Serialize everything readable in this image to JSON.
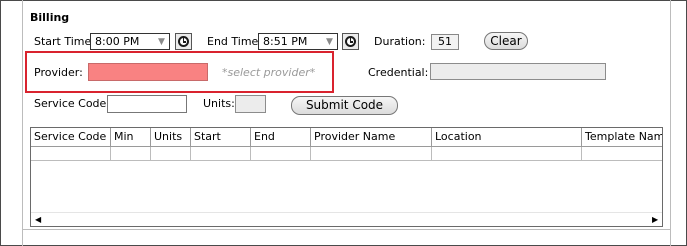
{
  "billing": {
    "title": "Billing",
    "start_time": {
      "label": "Start Time:",
      "value": "8:00 PM"
    },
    "end_time": {
      "label": "End Time:",
      "value": "8:51 PM"
    },
    "duration": {
      "label": "Duration:",
      "value": "51"
    },
    "clear_label": "Clear",
    "provider": {
      "label": "Provider:",
      "placeholder": "*select provider*"
    },
    "credential": {
      "label": "Credential:",
      "value": ""
    },
    "service_code": {
      "label": "Service Code:",
      "value": ""
    },
    "units": {
      "label": "Units:",
      "value": ""
    },
    "submit_label": "Submit Code"
  },
  "grid": {
    "columns": [
      "Service Code",
      "Min",
      "Units",
      "Start",
      "End",
      "Provider Name",
      "Location",
      "Template Name"
    ],
    "rows": [
      [
        "",
        "",
        "",
        "",
        "",
        "",
        "",
        ""
      ]
    ]
  },
  "icons": {
    "dropdown": "dropdown-arrow-icon",
    "clock": "clock-icon",
    "scroll_left": "scroll-left-icon",
    "scroll_right": "scroll-right-icon"
  },
  "colors": {
    "highlight": "#d9232e",
    "provider_required": "#f98282"
  }
}
